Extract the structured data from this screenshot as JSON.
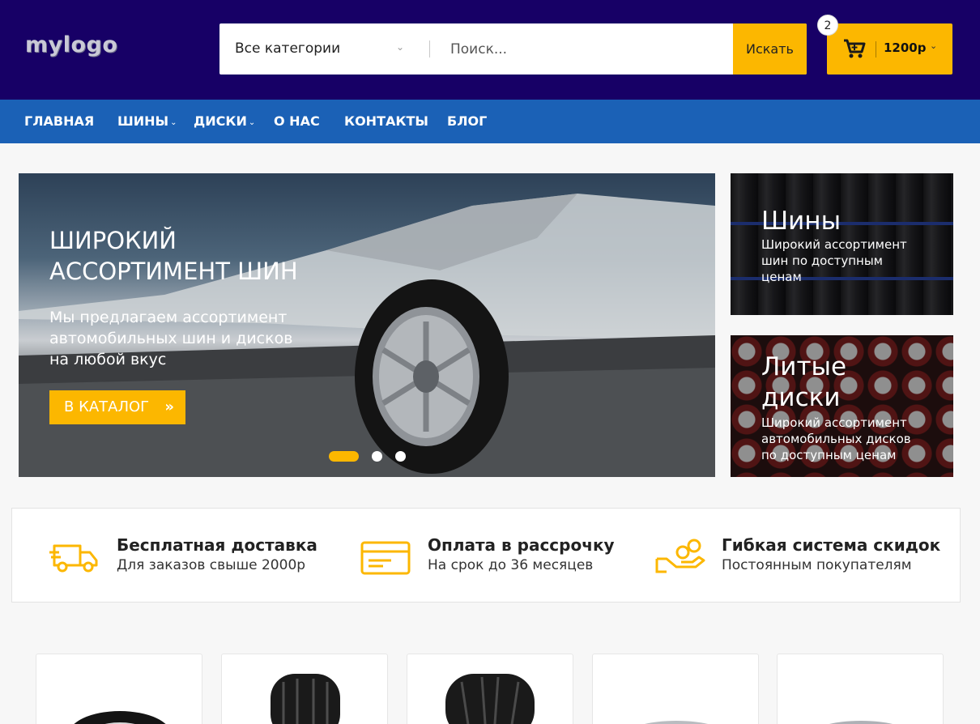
{
  "header": {
    "logo": "mylogo",
    "category_select": "Все категории",
    "search_placeholder": "Поиск...",
    "search_button": "Искать",
    "cart_count": "2",
    "cart_total": "1200р"
  },
  "nav": {
    "items": [
      {
        "label": "ГЛАВНАЯ"
      },
      {
        "label": "ШИНЫ"
      },
      {
        "label": "ДИСКИ"
      },
      {
        "label": "О НАС"
      },
      {
        "label": "КОНТАКТЫ"
      },
      {
        "label": "БЛОГ"
      }
    ]
  },
  "hero": {
    "title": "ШИРОКИЙ АССОРТИМЕНТ ШИН",
    "text": "Мы предлагаем ассортимент автомобильных шин и дисков на любой вкус",
    "button": "В КАТАЛОГ",
    "slides_total": 3,
    "active_slide": 1
  },
  "banners": [
    {
      "title": "Шины",
      "text": "Широкий ассортимент шин по доступным ценам"
    },
    {
      "title": "Литые диски",
      "text": "Широкий ассортимент автомобильных дисков по доступным ценам"
    }
  ],
  "features": [
    {
      "icon": "delivery-truck-icon",
      "title": "Бесплатная доставка",
      "sub": "Для заказов свыше 2000р"
    },
    {
      "icon": "credit-card-icon",
      "title": "Оплата в рассрочку",
      "sub": "На срок до 36 месяцев"
    },
    {
      "icon": "hand-coins-icon",
      "title": "Гибкая система скидок",
      "sub": "Постоянным покупателям"
    }
  ],
  "products": [
    {
      "image": "tire-image"
    },
    {
      "image": "tire-image"
    },
    {
      "image": "tire-image"
    },
    {
      "image": "rim-image"
    },
    {
      "image": "rim-image"
    }
  ],
  "colors": {
    "header_bg": "#170066",
    "nav_bg": "#1b61b6",
    "accent": "#fcb700"
  }
}
